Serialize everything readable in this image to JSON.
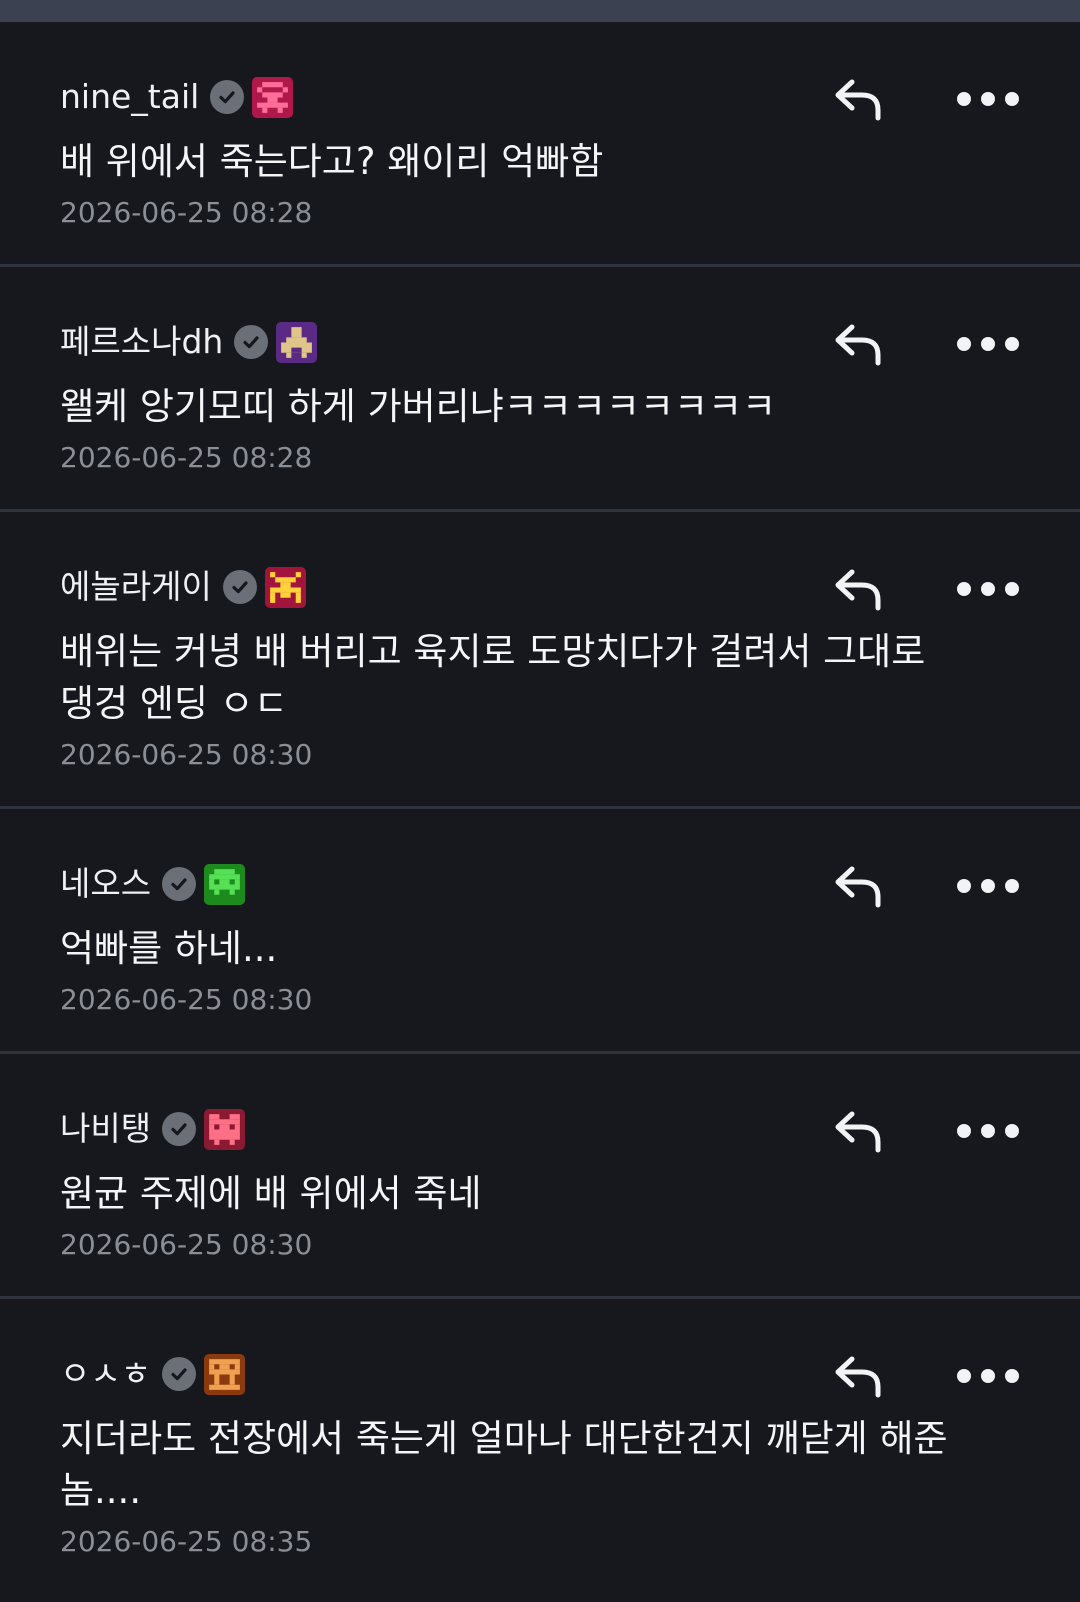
{
  "comments": [
    {
      "username": "nine_tail",
      "text": "배 위에서 죽는다고? 왜이리 억빠함",
      "date": "2026-06-25 08:28",
      "badge_icon": "pixel-creature-icon",
      "badge_bg": "#b0174a",
      "badge_fg": "#ff6f9a"
    },
    {
      "username": "페르소나dh",
      "text": "왤케 앙기모띠 하게 가버리냐ㅋㅋㅋㅋㅋㅋㅋㅋ",
      "date": "2026-06-25 08:28",
      "badge_icon": "pixel-creature-icon",
      "badge_bg": "#5b2a84",
      "badge_fg": "#e0c58a"
    },
    {
      "username": "에놀라게이",
      "text": "배위는 커녕 배 버리고 육지로 도망치다가 걸려서 그대로 댕겅 엔딩 ㅇㄷ",
      "date": "2026-06-25 08:30",
      "badge_icon": "pixel-creature-icon",
      "badge_bg": "#a3143c",
      "badge_fg": "#ffd23a"
    },
    {
      "username": "네오스",
      "text": "억빠를 하네...",
      "date": "2026-06-25 08:30",
      "badge_icon": "pixel-creature-icon",
      "badge_bg": "#1c8a1c",
      "badge_fg": "#55e055"
    },
    {
      "username": "나비탱",
      "text": "원균 주제에 배 위에서 죽네",
      "date": "2026-06-25 08:30",
      "badge_icon": "pixel-creature-icon",
      "badge_bg": "#8a1a32",
      "badge_fg": "#ff6f86"
    },
    {
      "username": "ㅇㅅㅎ",
      "text": "지더라도 전장에서 죽는게 얼마나 대단한건지 깨닫게 해준 놈....",
      "date": "2026-06-25 08:35",
      "badge_icon": "pixel-creature-icon",
      "badge_bg": "#8a3a0c",
      "badge_fg": "#f0a050"
    }
  ],
  "icons": {
    "reply": "reply-arrow-icon",
    "more": "more-dots-icon",
    "verified": "verified-check-icon"
  }
}
